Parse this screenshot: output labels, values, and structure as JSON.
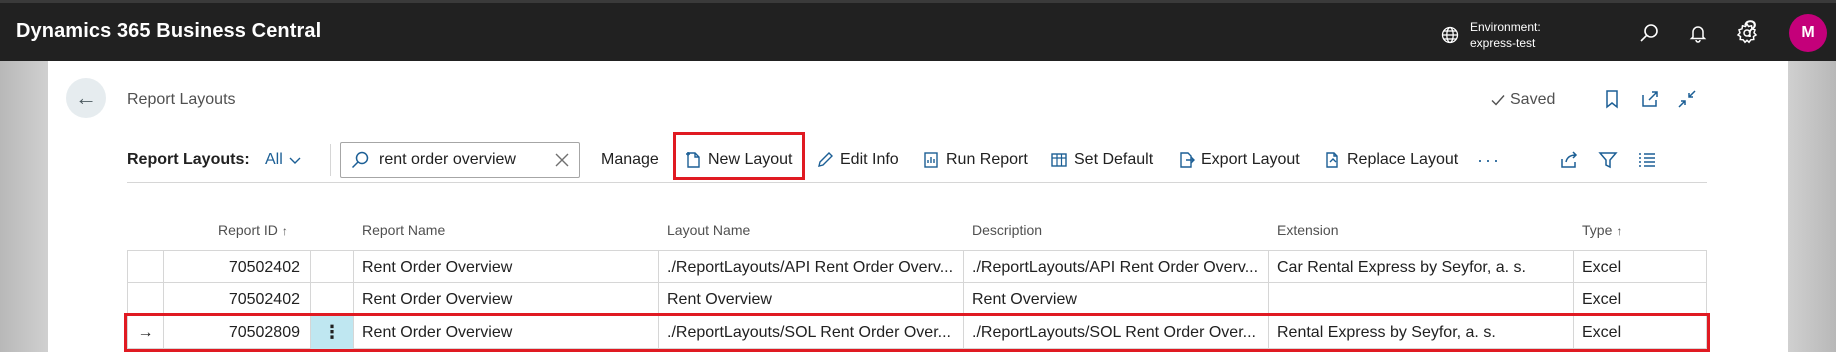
{
  "topbar": {
    "app_title": "Dynamics 365 Business Central",
    "environment_label": "Environment:",
    "environment_name": "express-test",
    "help_glyph": "?",
    "avatar_initial": "M",
    "icons": [
      "globe-icon",
      "search-icon",
      "bell-icon",
      "gear-icon",
      "help-icon"
    ]
  },
  "page": {
    "back_glyph": "←",
    "title": "Report Layouts",
    "saved_label": "Saved",
    "header_icons": [
      "bookmark-icon",
      "open-new-window-icon",
      "collapse-icon"
    ]
  },
  "action_bar": {
    "label": "Report Layouts:",
    "filter_value": "All",
    "search_value": "rent order overview",
    "buttons": {
      "manage": "Manage",
      "new_layout": "New Layout",
      "edit_info": "Edit Info",
      "run_report": "Run Report",
      "set_default": "Set Default",
      "export_layout": "Export Layout",
      "replace_layout": "Replace Layout"
    },
    "more_glyph": "···",
    "right_icons": [
      "share-icon",
      "filter-icon",
      "list-view-icon"
    ]
  },
  "grid": {
    "columns": {
      "report_id": "Report ID",
      "report_name": "Report Name",
      "layout_name": "Layout Name",
      "description": "Description",
      "extension": "Extension",
      "type": "Type"
    },
    "sort_arrow": "↑",
    "row_arrow": "→",
    "row_menu_glyph": "⋮",
    "rows": [
      {
        "report_id": "70502402",
        "report_name": "Rent Order Overview",
        "layout_name": "./ReportLayouts/API Rent Order Overv...",
        "description": "./ReportLayouts/API Rent Order Overv...",
        "extension": "Car Rental Express by Seyfor, a. s.",
        "type": "Excel"
      },
      {
        "report_id": "70502402",
        "report_name": "Rent Order Overview",
        "layout_name": "Rent Overview",
        "description": "Rent Overview",
        "extension": "",
        "type": "Excel"
      },
      {
        "report_id": "70502809",
        "report_name": "Rent Order Overview",
        "layout_name": "./ReportLayouts/SOL Rent Order Over...",
        "description": "./ReportLayouts/SOL Rent Order Over...",
        "extension": "Rental Express by Seyfor, a. s.",
        "type": "Excel"
      }
    ]
  },
  "colors": {
    "topbar_bg": "#212121",
    "accent": "#1c5f95",
    "highlight_red": "#e01a22",
    "avatar_bg": "#c4007a",
    "selected_cell": "#bfe7f1"
  }
}
